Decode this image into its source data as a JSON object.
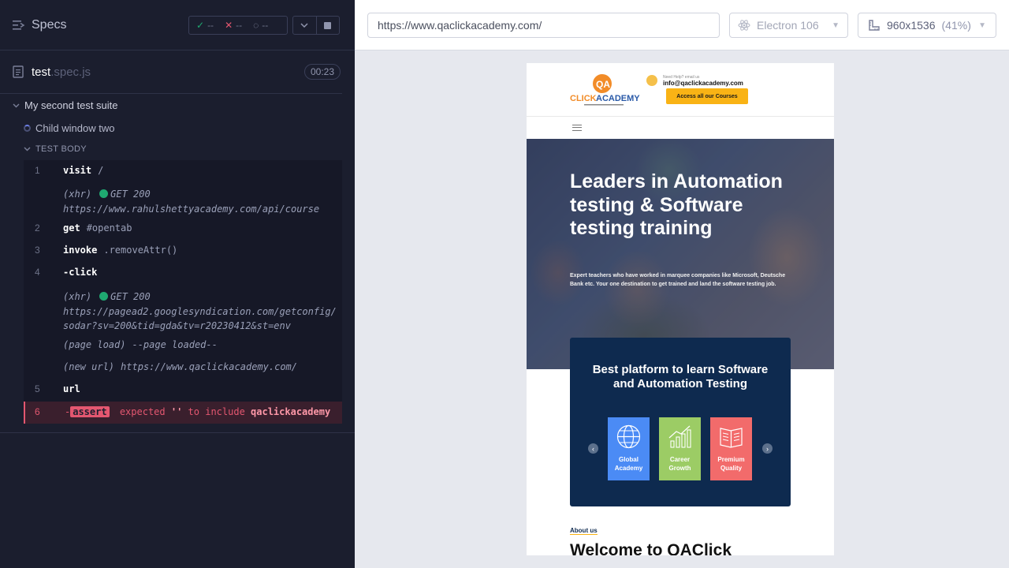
{
  "reporter": {
    "header": {
      "title": "Specs",
      "passed": "--",
      "failed": "--",
      "pending": "--"
    },
    "spec": {
      "file_name": "test",
      "file_ext": ".spec.js",
      "duration": "00:23"
    },
    "suite_title": "My second test suite",
    "test_title": "Child window two",
    "test_body_label": "TEST BODY",
    "commands": [
      {
        "num": "1",
        "name": "visit",
        "arg": "/"
      },
      {
        "xhr_label": "(xhr)",
        "xhr_status": "GET 200",
        "xhr_url": "https://www.rahulshettyacademy.com/api/course"
      },
      {
        "num": "2",
        "name": "get",
        "arg": "#opentab"
      },
      {
        "num": "3",
        "name": "invoke",
        "arg": ".removeAttr()"
      },
      {
        "num": "4",
        "name": "-click"
      },
      {
        "xhr_label": "(xhr)",
        "xhr_status": "GET 200",
        "xhr_url": "https://pagead2.googlesyndication.com/getconfig/sodar?sv=200&tid=gda&tv=r20230412&st=env"
      },
      {
        "label": "(page load)",
        "text": "--page loaded--"
      },
      {
        "label": "(new url)",
        "text": "https://www.qaclickacademy.com/"
      },
      {
        "num": "5",
        "name": "url"
      },
      {
        "num": "6",
        "prefix": "-",
        "name": "assert",
        "expected": "expected",
        "quoted": "''",
        "to_include": "to include",
        "value": "qaclickacademy"
      }
    ]
  },
  "aut_bar": {
    "url": "https://www.qaclickacademy.com/",
    "browser": "Electron 106",
    "viewport": "960x1536",
    "zoom": "(41%)"
  },
  "site": {
    "help_text": "Need Help? email us",
    "help_email": "info@qaclickacademy.com",
    "access_button": "Access all our Courses",
    "logo_text": "CLICK ACADEMY",
    "hero_title": "Leaders in Automation testing & Software testing training",
    "hero_sub": "Expert teachers who have worked in marquee companies like Microsoft, Deutsche Bank etc. Your one destination to get trained and land the software testing job.",
    "card_title": "Best platform to learn Software and Automation Testing",
    "tiles": [
      {
        "label": "Global Academy",
        "color": "#4b8bf5"
      },
      {
        "label": "Career Growth",
        "color": "#9ccc65"
      },
      {
        "label": "Premium Quality",
        "color": "#f26b6b"
      }
    ],
    "about": "About us",
    "welcome": "Welcome to QAClick"
  }
}
